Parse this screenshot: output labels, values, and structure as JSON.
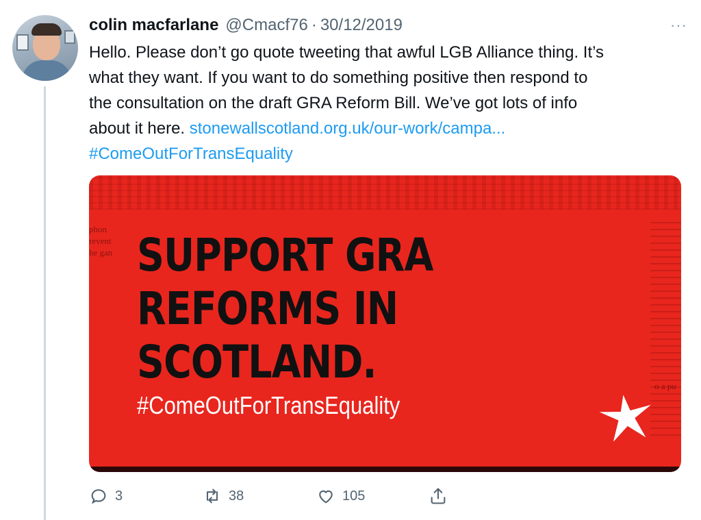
{
  "tweet": {
    "author_name": "colin macfarlane",
    "handle": "@Cmacf76",
    "separator": "·",
    "date": "30/12/2019",
    "more_label": "···",
    "text_lines": [
      "Hello. Please don’t go quote tweeting that awful LGB Alliance thing. It’s",
      "what they want. If you want to do something positive then respond to",
      "the consultation on the draft GRA Reform Bill.  We’ve got lots of info"
    ],
    "last_line_text": "about it here. ",
    "link_text": "stonewallscotland.org.uk/our-work/campa...",
    "hashtag": "#ComeOutForTransEquality"
  },
  "media": {
    "headline_lines": [
      "SUPPORT GRA",
      "REFORMS IN",
      "SCOTLAND."
    ],
    "hashtag": "#ComeOutForTransEquality",
    "left_paper_text": [
      "phon",
      "revent",
      "he gan"
    ],
    "right_paper_text": "o a pu",
    "background_color": "#e8261e"
  },
  "actions": {
    "reply_count": "3",
    "retweet_count": "38",
    "like_count": "105"
  },
  "icons": {
    "avatar": "user-avatar",
    "more": "more-options-icon",
    "reply": "reply-icon",
    "retweet": "retweet-icon",
    "like": "heart-icon",
    "share": "share-icon",
    "star": "stonewall-star-logo"
  },
  "colors": {
    "link": "#1d9bf0",
    "muted": "#536471",
    "text": "#0f1419"
  }
}
